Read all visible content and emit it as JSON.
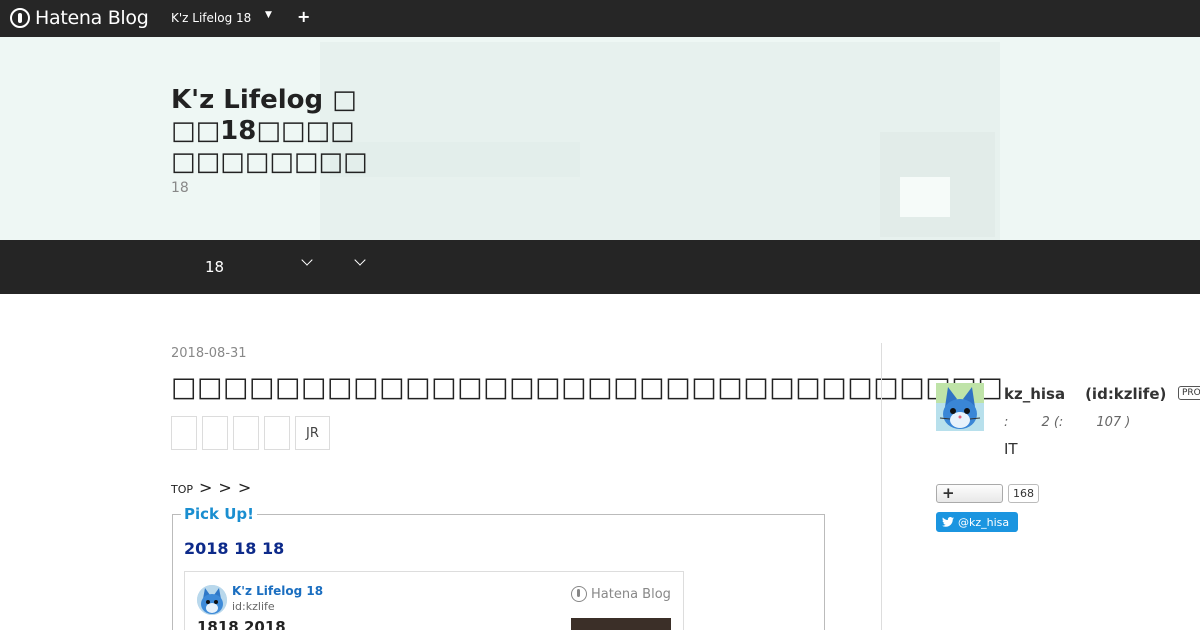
{
  "globalbar": {
    "logo": "Hatena Blog",
    "blog_name": "K'z Lifelog 18",
    "caret_icon": "caret-down-icon",
    "plus_icon": "plus-icon"
  },
  "header": {
    "title": "K'z Lifelog □□□18□□□□□□□□□□□□",
    "description": "18"
  },
  "nav": {
    "item1": "18",
    "chevron_icon": "chevron-down-icon"
  },
  "entry": {
    "date": "2018-08-31",
    "title": "□□□□□□□□□□□□□□□□□□□□□□□□□□□□□□□□",
    "categories": [
      "",
      "",
      "",
      "",
      "JR"
    ],
    "breadcrumb": {
      "top": "TOP",
      "sep": ">"
    },
    "pickup": {
      "legend": "Pick Up!",
      "heading": "2018 18 18",
      "card": {
        "blog_name": "K'z Lifelog 18",
        "id": "id:kzlife",
        "logo": "Hatena Blog",
        "title": "1818 2018"
      }
    }
  },
  "sidebar": {
    "name": "kz_hisa",
    "id": "(id:kzlife)",
    "badge": "PRO",
    "stats": ":        2 (:        107 )",
    "bio": "IT",
    "hatebu_count": "168",
    "twitter_handle": "@kz_hisa"
  },
  "colors": {
    "bar": "#262626",
    "header_bg": "#eef7f4",
    "accent_blue": "#1a8ed0",
    "twitter": "#1b95e0"
  }
}
